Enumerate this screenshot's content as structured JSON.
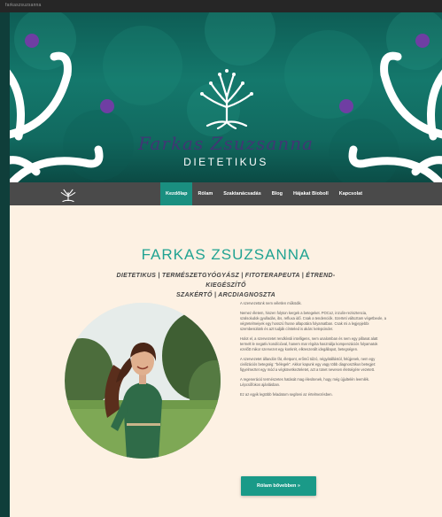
{
  "browser": {
    "tab_text": "farkaszsuzsanna"
  },
  "brand": {
    "name_script": "Farkas Zsuzsanna",
    "tagline": "DIETETIKUS"
  },
  "colors": {
    "accent": "#1a9a88",
    "hero": "#14786c",
    "purple": "#6f3ea3",
    "nav": "#4a4a4a",
    "page_bg": "#fdf1e3"
  },
  "nav": {
    "items": [
      {
        "label": "Kezdőlap",
        "active": true
      },
      {
        "label": "Rólam",
        "active": false
      },
      {
        "label": "Szaktanácsadás",
        "active": false
      },
      {
        "label": "Blog",
        "active": false
      },
      {
        "label": "Hájakat Bioboll",
        "active": false
      },
      {
        "label": "Kapcsolat",
        "active": false
      }
    ]
  },
  "main": {
    "title": "FARKAS ZSUZSANNA",
    "subtitle_line1": "DIETETIKUS | TERMÉSZETGYÓGYÁSZ | FITOTERAPEUTA | ÉTREND-KIEGÉSZÍTŐ",
    "subtitle_line2": "SZAKÉRTŐ | ARCDIAGNOSZTA",
    "paragraphs": [
      "A szervezetünk nem véletlen működik.",
      "Nemez életem, hiszen folyton kergek a betegeket. POCoz, inzulin-rezisztencia, szalsoludok gyulladás, ibs, refluxa idő. Csak a tendenciók. Szerteti változtam végetbeole, a végretelmeiyek egy hosszú frusse allapotára folyamatban. Csak mi a legjepjebbi szembesülünk és azt tudják címteled is akárc kelepcinder.",
      "Holot el, a szervezetet rendkívüli intelligens, nem unalomban és nem egy pillanat alatt termelt le negatív kondícióval, hanem mar régóta használja kompenzációs folyamatok ezelőtt mikor szervezet egy konkrét, elkreszerált idegállapot, betegségen.",
      "A szervezetet állandón fát, életpont, erőmű túlzó, négyátállástól, felújjenek, nem egy civilizációs betegség: \"bélegek\". Akkor kapunk egy vagy több diagnosztikus betegjet: figyelmeztet egy mód a végkövetkezteletet, azt a tünet nevesen életségére vezetett.",
      "A regeneráció természetes hatását mag élesítenek, hogy még újjultelén leemlék. Lépcsőfokos ajánlásban.",
      "Ez az egyik legtöbb feladatom segíteni az értelmezésben."
    ],
    "cta_label": "Rólam bővebben »"
  },
  "icons": {
    "logo": "tree-of-life-icon",
    "nav_logo": "tree-of-life-icon"
  }
}
